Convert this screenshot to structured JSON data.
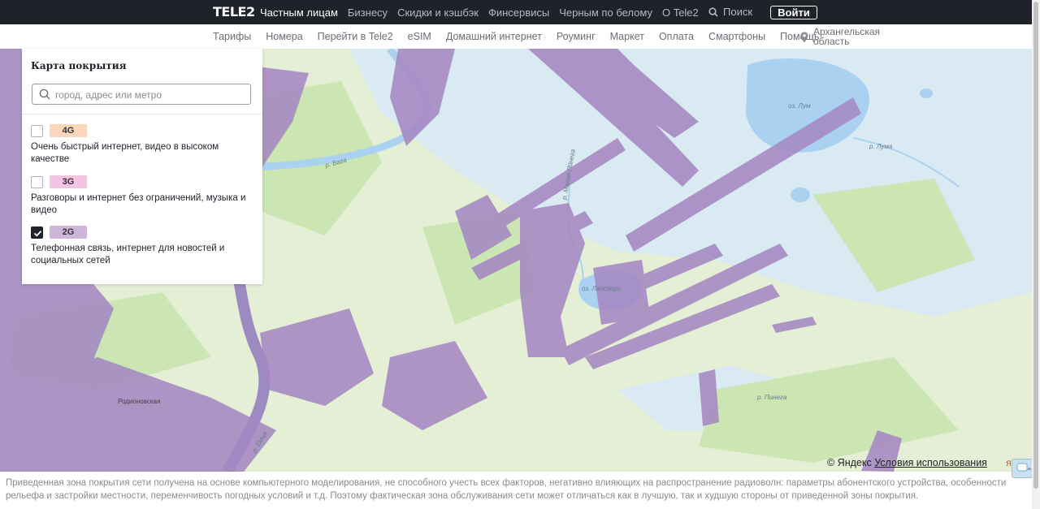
{
  "header": {
    "logo": "TELE2",
    "nav": [
      "Частным лицам",
      "Бизнесу",
      "Скидки и кэшбэк",
      "Финсервисы",
      "Черным по белому",
      "О Tele2"
    ],
    "active_nav": "Частным лицам",
    "search_label": "Поиск",
    "login_label": "Войти"
  },
  "subnav": {
    "items": [
      "Тарифы",
      "Номера",
      "Перейти в Tele2",
      "eSIM",
      "Домашний интернет",
      "Роуминг",
      "Маркет",
      "Оплата",
      "Смартфоны",
      "Помощь"
    ],
    "region": "Архангельская область"
  },
  "panel": {
    "title": "Карта покрытия",
    "search_placeholder": "город, адрес или метро",
    "layers": [
      {
        "badge": "4G",
        "color": "#fcd6bb",
        "checked": false,
        "desc": "Очень быстрый интернет, видео в высоком качестве"
      },
      {
        "badge": "3G",
        "color": "#f5c3e3",
        "checked": false,
        "desc": "Разговоры и интернет без ограничений, музыка и видео"
      },
      {
        "badge": "2G",
        "color": "#cdb6d9",
        "checked": true,
        "desc": "Телефонная связь, интернет для новостей и социальных сетей"
      }
    ]
  },
  "map": {
    "labels": {
      "lake_lum": "оз. Лум",
      "river_luma": "р. Лума",
      "river_malaya_pinega": "р. Малая Пинега",
      "lake_lapozero": "оз. Лапозеро",
      "river_pinega": "р. Пинега",
      "river_vaga": "р. Вага",
      "town_rodionovskaya": "Родионовская",
      "river_yomtsa": "р. Ёмца"
    },
    "attribution_prefix": "© Яндекс",
    "terms_link": "Условия использования",
    "yandex_mark": "Яндекс",
    "colors": {
      "coverage_2g": "#a588c2",
      "land": "#e4efd6",
      "forest": "#cbe5b3",
      "water": "#aad2f0"
    }
  },
  "footer": {
    "disclaimer": "Приведенная зона покрытия сети получена на основе компьютерного моделирования, не способного учесть всех факторов, негативно влияющих на распространение радиоволн: параметры абонентского устройства, особенности рельефа и застройки местности, переменчивость погодных условий и т.д. Поэтому фактическая зона обслуживания сети может отличаться как в лучшую, так и худшую стороны от приведенной зоны покрытия."
  }
}
